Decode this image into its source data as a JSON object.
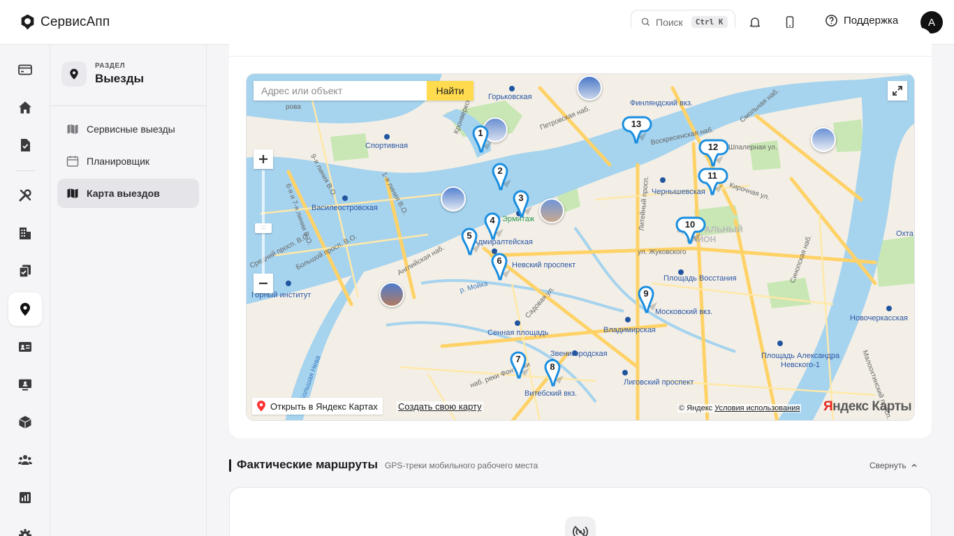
{
  "app": {
    "name": "СервисАпп"
  },
  "topbar": {
    "search_label": "Поиск",
    "search_shortcut": "Ctrl K",
    "support_label": "Поддержка",
    "avatar_initial": "A"
  },
  "rail": {
    "items": [
      "card-icon",
      "home-icon",
      "document-check-icon",
      "tools-icon",
      "building-icon",
      "tasks-icon",
      "location-pin-icon",
      "id-card-icon",
      "monitor-user-icon",
      "box-icon",
      "users-icon",
      "chart-icon",
      "settings-icon"
    ],
    "active": "location-pin-icon"
  },
  "panel": {
    "kicker": "РАЗДЕЛ",
    "title": "Выезды",
    "items": [
      {
        "label": "Сервисные выезды",
        "icon": "map-icon",
        "active": false
      },
      {
        "label": "Планировщик",
        "icon": "calendar-icon",
        "active": false
      },
      {
        "label": "Карта выездов",
        "icon": "map-icon",
        "active": true
      }
    ]
  },
  "map": {
    "search_placeholder": "Адрес или объект",
    "find_label": "Найти",
    "open_yandex_label": "Открыть в Яндекс Картах",
    "create_map_label": "Создать свою карту",
    "copyright": "© Яндекс",
    "terms_label": "Условия использования",
    "logo_first": "Я",
    "logo_rest": "ндекс Карты",
    "labels": {
      "gorkovskaya": "Горьковская",
      "sportivnaya": "Спортивная",
      "vasileostrovskaya": "Василеостровская",
      "finlyandsky": "Финляндский вкз.",
      "chernyshevskaya": "Чернышевская",
      "ermitazh": "Эрмитаж",
      "admiralteyskaya": "Адмиралтейская",
      "nevsky": "Невский проспект",
      "gorny": "Горный институт",
      "sennaya": "Сенная площадь",
      "ploshchad_vosstaniya": "Площадь Восстания",
      "moskovsky_vkz": "Московский вкз.",
      "vladimirskaya": "Владимирская",
      "zvenigorodskaya": "Звенигородская",
      "ligovsky": "Лиговский проспект",
      "vitebsky": "Витебский вкз.",
      "novocherkasskaya": "Новочеркасская",
      "ploshchad_alexandra": "Площадь Александра",
      "nevskogo": "Невского-1",
      "tsentralny": "ЦЕНТРАЛЬНЫЙ",
      "rayon": "РАЙОН",
      "okhta": "Охта",
      "zhukovskogo": "ул. Жуковского",
      "voskresenskaya": "Воскресенская наб.",
      "shpalernaya": "Шпалерная ул.",
      "kirochnaya": "Кирочная ул.",
      "sadovaya": "Садовая ул.",
      "petrovskaya": "Петровская наб.",
      "smolnaya": "Смольная наб.",
      "liteyny": "Литейный просп.",
      "angliyskaya": "Английская наб.",
      "moyka": "р. Мойка",
      "fontanki": "наб. реки Фонтанки",
      "bolshaya_neva": "р. Большая Нева",
      "line9": "9-я линия В.О.",
      "line1": "1-я линия В.О.",
      "line6": "6-я и 7-я линии В.О.",
      "sredny": "Средний просп. В.О.",
      "bolshoy": "Большой просп. В.О.",
      "sinopskaya": "Синопская наб.",
      "malookhtinsky": "Малоохтинский просп.",
      "kronverksky": "Кронверкск.",
      "kirovskaya": "ровa"
    },
    "pins": [
      "1",
      "2",
      "3",
      "4",
      "5",
      "6",
      "7",
      "8",
      "9",
      "10",
      "11",
      "12",
      "13"
    ],
    "colors": {
      "water": "#a6d3ee",
      "land": "#f3efe6",
      "park": "#c9e7b4",
      "road": "#ffd268",
      "pin": "#1a8ee0"
    }
  },
  "routes": {
    "title": "Фактические маршруты",
    "subtitle": "GPS-треки мобильного рабочего места",
    "collapse_label": "Свернуть",
    "empty_icon": "signal-off-icon"
  }
}
